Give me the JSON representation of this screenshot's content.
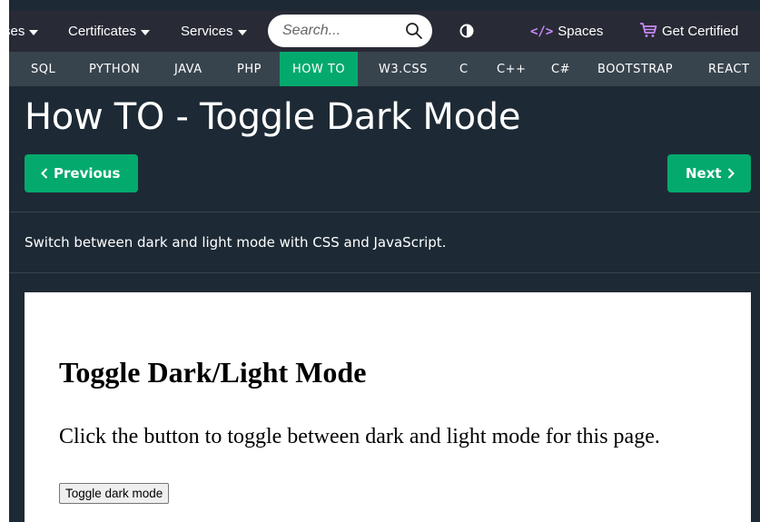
{
  "topnav": {
    "tutorials_label": "ses",
    "certificates_label": "Certificates",
    "services_label": "Services",
    "search_placeholder": "Search...",
    "spaces_glyph": "</>",
    "spaces_label": "Spaces",
    "certified_label": "Get Certified"
  },
  "subjects": {
    "items": [
      "SQL",
      "PYTHON",
      "JAVA",
      "PHP",
      "HOW TO",
      "W3.CSS",
      "C",
      "C++",
      "C#",
      "BOOTSTRAP",
      "REACT"
    ],
    "active": "HOW TO"
  },
  "page": {
    "title": "How TO - Toggle Dark Mode",
    "prev_label": "Previous",
    "next_label": "Next",
    "intro": "Switch between dark and light mode with CSS and JavaScript."
  },
  "example": {
    "heading": "Toggle Dark/Light Mode",
    "text": "Click the button to toggle between dark and light mode for this page.",
    "button_label": "Toggle dark mode"
  },
  "colors": {
    "page_bg": "#1d2a35",
    "topnav_bg": "#282a35",
    "subjectnav_bg": "#38444d",
    "accent_green": "#04aa6d",
    "spaces_purple": "#c88bff"
  },
  "icons": {
    "search": "search-icon",
    "contrast": "contrast-icon",
    "cart": "cart-icon",
    "prev": "chevron-left-icon",
    "next": "chevron-right-icon"
  }
}
